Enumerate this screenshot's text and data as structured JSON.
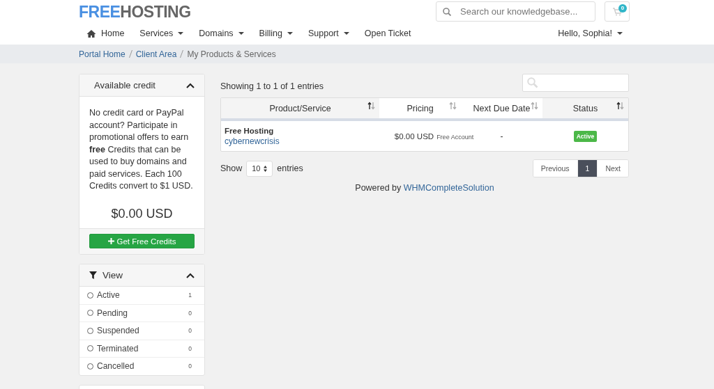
{
  "header": {
    "logo_part_1": "FREE",
    "logo_part_2": "HOSTING",
    "search": {
      "placeholder": "Search our knowledgebase..."
    },
    "cart_count": "0"
  },
  "nav": [
    {
      "label": "Home",
      "kind": "home",
      "dropdown": false
    },
    {
      "label": "Services",
      "kind": "menu",
      "dropdown": true
    },
    {
      "label": "Domains",
      "kind": "menu",
      "dropdown": true
    },
    {
      "label": "Billing",
      "kind": "menu",
      "dropdown": true
    },
    {
      "label": "Support",
      "kind": "menu",
      "dropdown": true
    },
    {
      "label": "Open Ticket",
      "kind": "menu",
      "dropdown": false
    }
  ],
  "user_menu": {
    "label": "Hello, Sophia!"
  },
  "breadcrumb": [
    {
      "label": "Portal Home",
      "link": true
    },
    {
      "label": "Client Area",
      "link": true
    },
    {
      "label": "My Products & Services",
      "link": false
    }
  ],
  "credit_panel": {
    "title": "Available credit",
    "text": "No credit card or PayPal account? Participate in promotional offers to earn **free** Credits that can be used to buy domains and paid services. Each 100 Credits convert to $1 USD.",
    "amount": "$0.00 USD",
    "button": "Get Free Credits"
  },
  "view_panel": {
    "title": "View",
    "items": [
      {
        "label": "Active",
        "count": "1",
        "selected": false
      },
      {
        "label": "Pending",
        "count": "0",
        "selected": false
      },
      {
        "label": "Suspended",
        "count": "0",
        "selected": false
      },
      {
        "label": "Terminated",
        "count": "0",
        "selected": false
      },
      {
        "label": "Cancelled",
        "count": "0",
        "selected": false
      }
    ]
  },
  "table": {
    "info": "Showing 1 to 1 of 1 entries",
    "columns": [
      {
        "label": "Product/Service",
        "sorted": true
      },
      {
        "label": "Pricing",
        "sorted": false
      },
      {
        "label": "Next Due Date",
        "sorted": false
      },
      {
        "label": "Status",
        "sorted": true
      }
    ],
    "rows": [
      {
        "product": "Free Hosting",
        "domain": "cybernewcrisis",
        "price": "$0.00 USD",
        "cycle": "Free Account",
        "due": "-",
        "status": "Active"
      }
    ],
    "length": {
      "prefix": "Show",
      "value": "10",
      "suffix": "entries"
    },
    "pagination": [
      {
        "label": "Previous",
        "selected": false
      },
      {
        "label": "1",
        "selected": true
      },
      {
        "label": "Next",
        "selected": false
      }
    ]
  },
  "footer": {
    "prefix": "Powered by",
    "link": "WHMCompleteSolution"
  }
}
